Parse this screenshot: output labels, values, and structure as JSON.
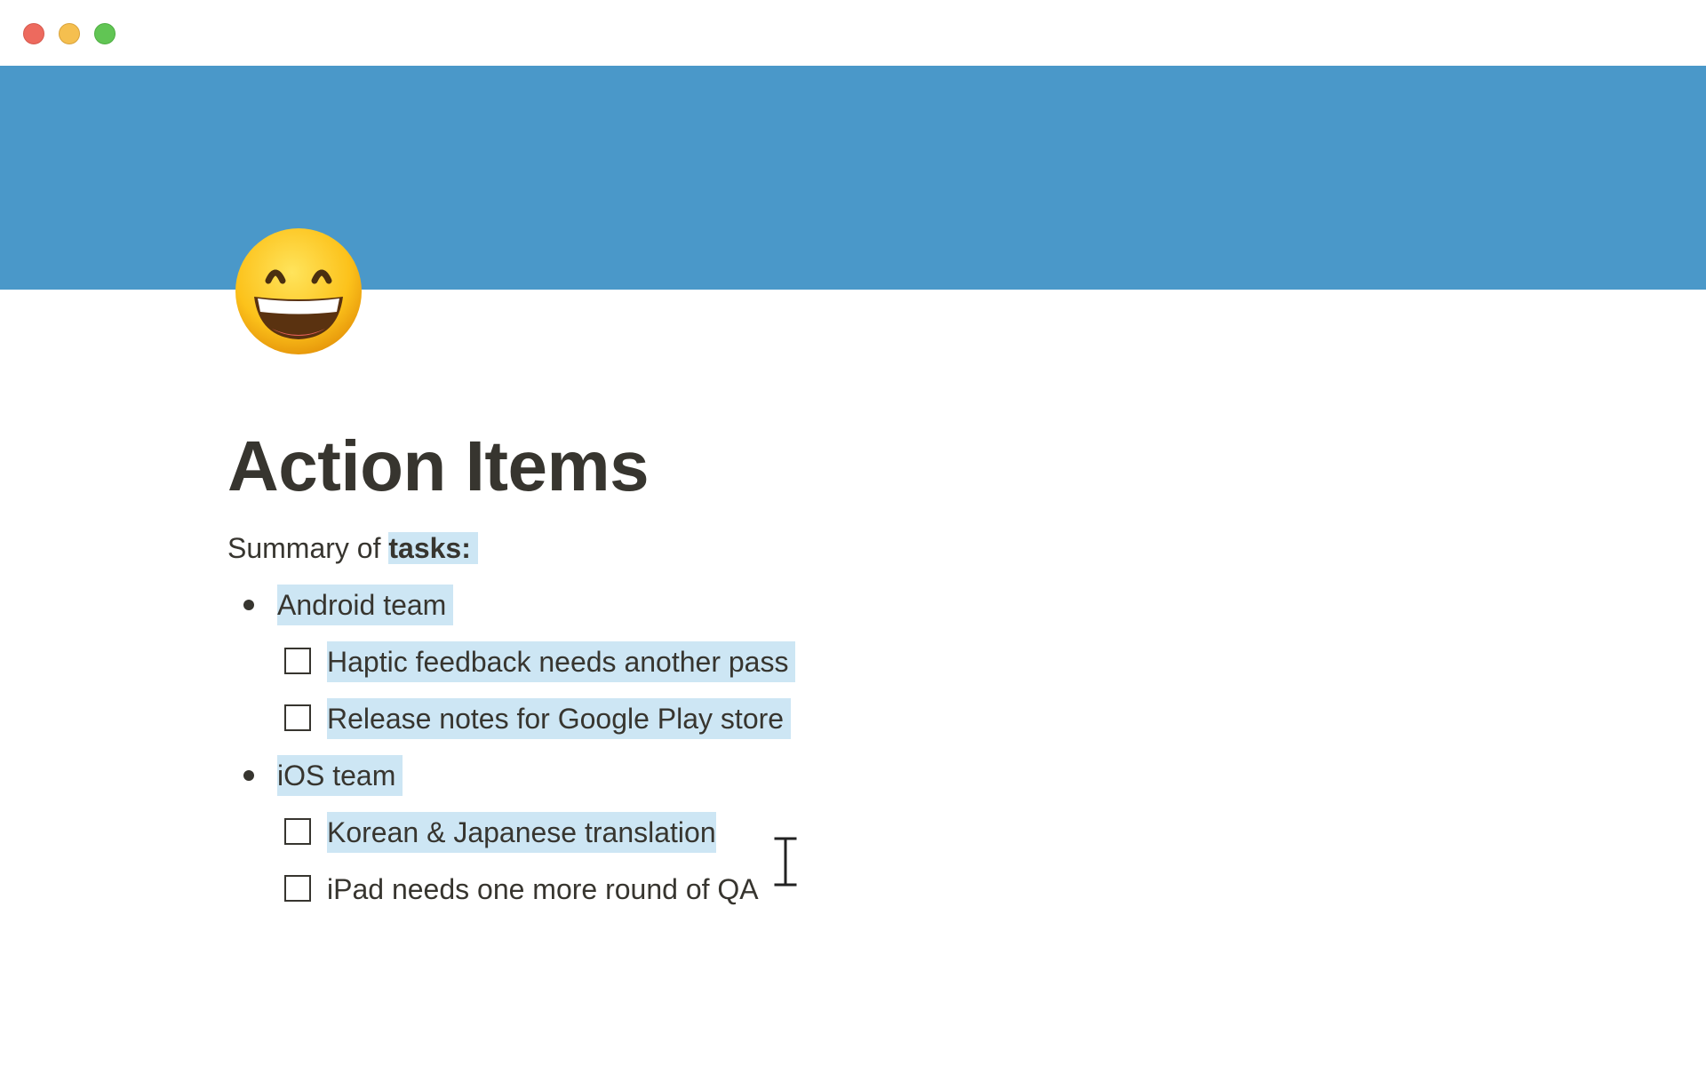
{
  "window": {
    "controls": [
      "close",
      "minimize",
      "zoom"
    ]
  },
  "colors": {
    "cover": "#4a98c9",
    "text": "#37352f",
    "selection": "#cde6f4"
  },
  "page": {
    "icon": "grinning-face-with-smiling-eyes-emoji",
    "title": "Action Items",
    "summary_prefix": "Summary of ",
    "summary_bold": "tasks:"
  },
  "sections": [
    {
      "label": "Android team",
      "todos": [
        {
          "text": "Haptic feedback needs another pass",
          "checked": false,
          "selected": true
        },
        {
          "text": "Release notes for Google Play store",
          "checked": false,
          "selected": true
        }
      ]
    },
    {
      "label": "iOS team",
      "todos": [
        {
          "text": "Korean & Japanese translation",
          "checked": false,
          "selected": true
        },
        {
          "text": "iPad needs one more round of QA",
          "checked": false,
          "selected": false
        }
      ]
    }
  ],
  "cursor": "text-cursor-icon"
}
